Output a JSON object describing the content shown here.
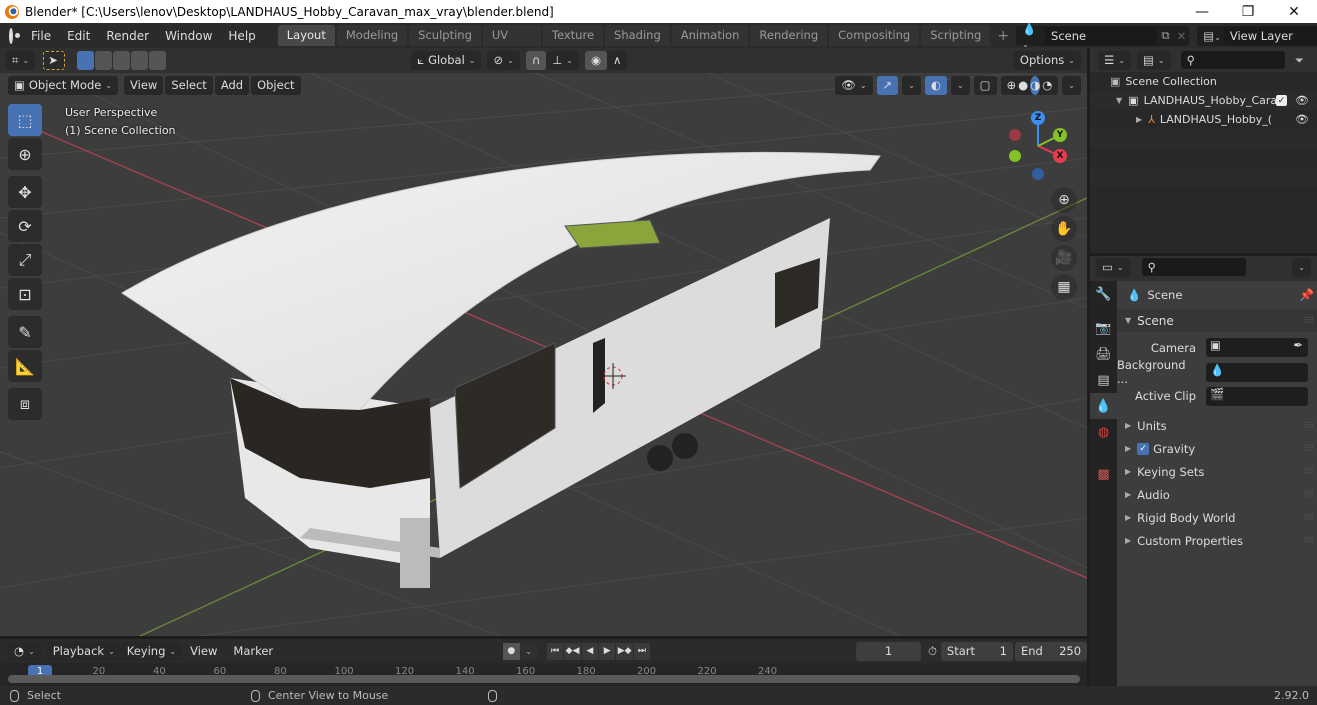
{
  "window": {
    "title": "Blender* [C:\\Users\\lenov\\Desktop\\LANDHAUS_Hobby_Caravan_max_vray\\blender.blend]",
    "minimize": "—",
    "maximize": "❐",
    "close": "✕"
  },
  "menubar": {
    "items": [
      "File",
      "Edit",
      "Render",
      "Window",
      "Help"
    ],
    "workspaces": [
      "Layout",
      "Modeling",
      "Sculpting",
      "UV Editing",
      "Texture Paint",
      "Shading",
      "Animation",
      "Rendering",
      "Compositing",
      "Scripting"
    ],
    "active_workspace": "Layout",
    "add_workspace": "+",
    "scene": "Scene",
    "view_layer": "View Layer"
  },
  "viewport_header": {
    "transform_orientation": "Global",
    "options": "Options",
    "mode": "Object Mode",
    "menus": [
      "View",
      "Select",
      "Add",
      "Object"
    ]
  },
  "viewport": {
    "perspective_label": "User Perspective",
    "collection_label": "(1) Scene Collection",
    "gizmo_axes": {
      "x": "X",
      "y": "Y",
      "z": "Z"
    },
    "colors": {
      "x_axis": "#e83b50",
      "y_axis": "#84c225",
      "z_axis": "#3b8ff0"
    }
  },
  "toolbar": {
    "tools": [
      "select-box",
      "cursor",
      "move",
      "rotate",
      "scale",
      "transform",
      "annotate",
      "measure",
      "add-cube"
    ],
    "active_tool": "select-box"
  },
  "outliner": {
    "search_placeholder": "",
    "rows": [
      {
        "label": "Scene Collection",
        "level": 0
      },
      {
        "label": "LANDHAUS_Hobby_Cara",
        "level": 1,
        "checked": true,
        "visible": true
      },
      {
        "label": "LANDHAUS_Hobby_(",
        "level": 2,
        "visible": true
      }
    ]
  },
  "properties": {
    "context_title": "Scene",
    "panel_title": "Scene",
    "fields": [
      {
        "label": "Camera",
        "value": ""
      },
      {
        "label": "Background ...",
        "value": ""
      },
      {
        "label": "Active Clip",
        "value": ""
      }
    ],
    "subpanels": [
      {
        "label": "Units"
      },
      {
        "label": "Gravity",
        "checked": true
      },
      {
        "label": "Keying Sets"
      },
      {
        "label": "Audio"
      },
      {
        "label": "Rigid Body World"
      },
      {
        "label": "Custom Properties"
      }
    ]
  },
  "timeline": {
    "menus": [
      "Playback",
      "Keying",
      "View",
      "Marker"
    ],
    "current_frame": "1",
    "start_label": "Start",
    "start": "1",
    "end_label": "End",
    "end": "250",
    "ruler_ticks": [
      "1",
      "20",
      "40",
      "60",
      "80",
      "100",
      "120",
      "140",
      "160",
      "180",
      "200",
      "220",
      "240"
    ]
  },
  "statusbar": {
    "left_action": "Select",
    "middle_action": "Center View to Mouse",
    "version": "2.92.0"
  }
}
